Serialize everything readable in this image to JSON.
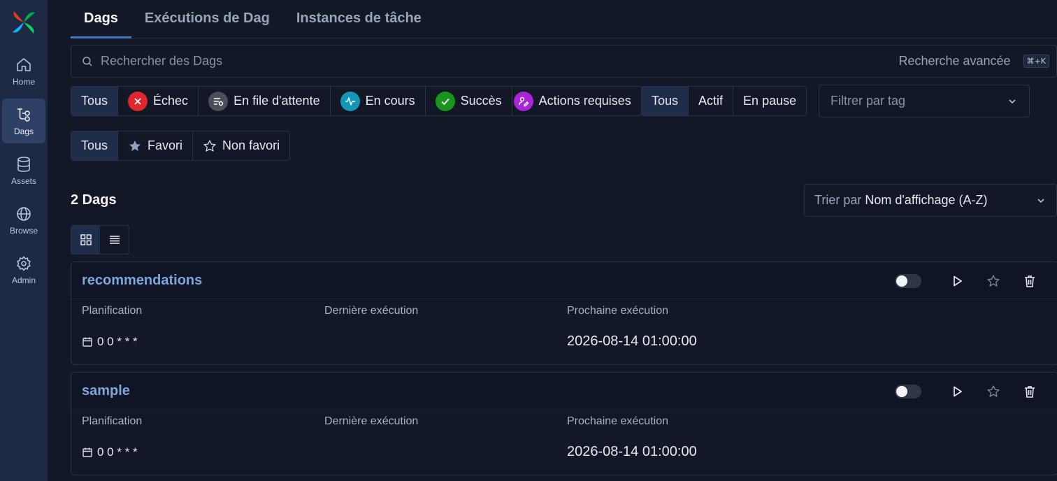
{
  "sidebar": {
    "items": [
      {
        "label": "Home",
        "icon": "home-icon"
      },
      {
        "label": "Dags",
        "icon": "dags-icon"
      },
      {
        "label": "Assets",
        "icon": "database-icon"
      },
      {
        "label": "Browse",
        "icon": "globe-icon"
      },
      {
        "label": "Admin",
        "icon": "gear-icon"
      }
    ]
  },
  "tabs": [
    "Dags",
    "Exécutions de Dag",
    "Instances de tâche"
  ],
  "search": {
    "placeholder": "Rechercher des Dags",
    "advanced": "Recherche avancée",
    "shortcut": "⌘+K"
  },
  "state_filters": {
    "all": "Tous",
    "failed": "Échec",
    "queued": "En file d'attente",
    "running": "En cours",
    "success": "Succès",
    "actions": "Actions requises"
  },
  "status_colors": {
    "failed": "#e0262e",
    "queued": "#4b4f57",
    "running": "#1297b9",
    "success": "#17951d",
    "actions": "#a925d8"
  },
  "active_filters": {
    "all": "Tous",
    "active": "Actif",
    "paused": "En pause"
  },
  "tag_filter": {
    "placeholder": "Filtrer par tag"
  },
  "fav_filters": {
    "all": "Tous",
    "fav": "Favori",
    "nonfav": "Non favori"
  },
  "dag_count": "2 Dags",
  "sort": {
    "label": "Trier par",
    "value": "Nom d'affichage (A-Z)"
  },
  "columns": {
    "schedule": "Planification",
    "last_run": "Dernière exécution",
    "next_run": "Prochaine exécution"
  },
  "dags": [
    {
      "name": "recommendations",
      "schedule": "0 0 * * *",
      "next_run": "2026-08-14 01:00:00"
    },
    {
      "name": "sample",
      "schedule": "0 0 * * *",
      "next_run": "2026-08-14 01:00:00"
    }
  ]
}
